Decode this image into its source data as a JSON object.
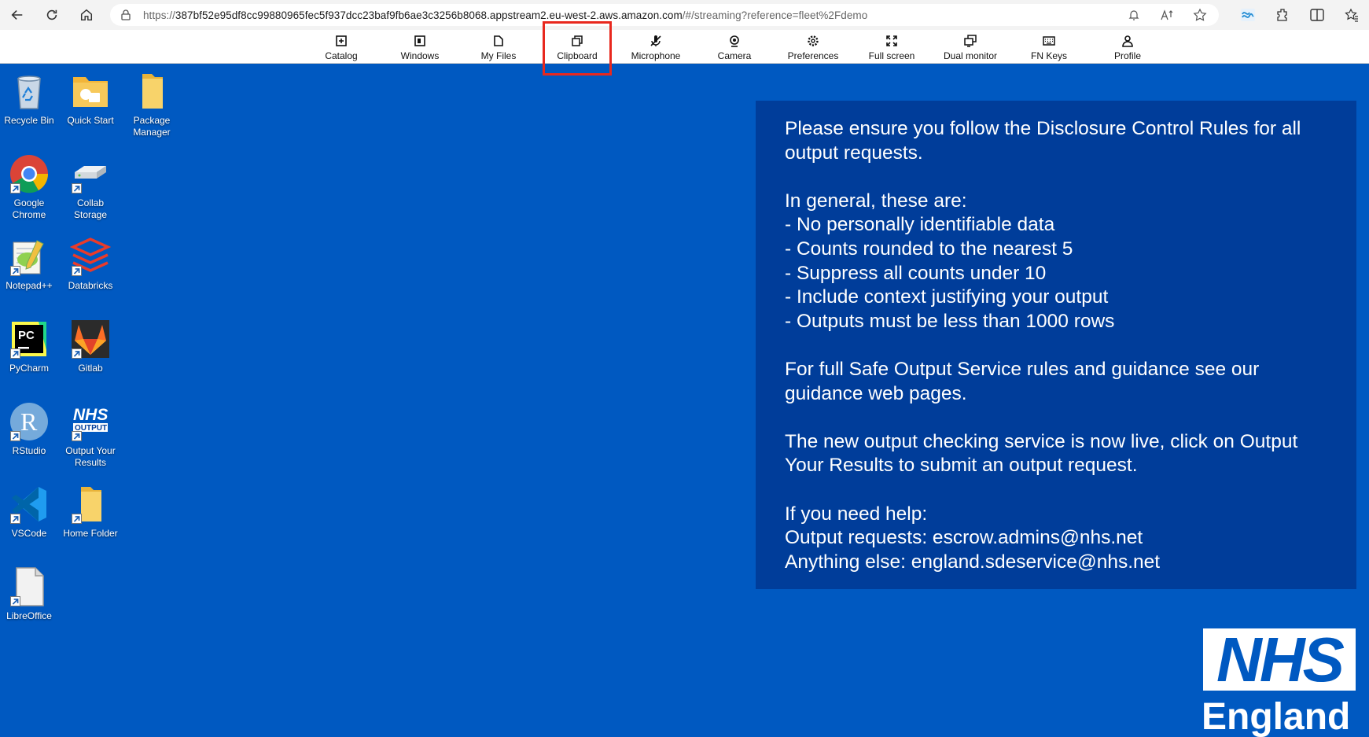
{
  "browser": {
    "url_prefix": "https://",
    "url_host": "387bf52e95df8cc99880965fec5f937dcc23baf9fb6ae3c3256b8068.appstream2.eu-west-2.aws.amazon.com",
    "url_path": "/#/streaming?reference=fleet%2Fdemo"
  },
  "toolbar": {
    "items": [
      {
        "label": "Catalog",
        "icon": "catalog-icon"
      },
      {
        "label": "Windows",
        "icon": "windows-icon"
      },
      {
        "label": "My Files",
        "icon": "my-files-icon"
      },
      {
        "label": "Clipboard",
        "icon": "clipboard-icon"
      },
      {
        "label": "Microphone",
        "icon": "microphone-icon"
      },
      {
        "label": "Camera",
        "icon": "camera-icon"
      },
      {
        "label": "Preferences",
        "icon": "gear-icon"
      },
      {
        "label": "Full screen",
        "icon": "full-screen-icon"
      },
      {
        "label": "Dual monitor",
        "icon": "dual-monitor-icon"
      },
      {
        "label": "FN Keys",
        "icon": "keyboard-icon"
      },
      {
        "label": "Profile",
        "icon": "profile-icon"
      }
    ],
    "highlighted": "Clipboard",
    "highlight_color": "#e8281e"
  },
  "desktop": {
    "icons": [
      {
        "label": "Recycle Bin"
      },
      {
        "label": "Quick Start"
      },
      {
        "label": "Package Manager"
      },
      {
        "label": "Google Chrome"
      },
      {
        "label": "Collab Storage"
      },
      {
        "label": "Notepad++"
      },
      {
        "label": "Databricks"
      },
      {
        "label": "PyCharm"
      },
      {
        "label": "Gitlab"
      },
      {
        "label": "RStudio"
      },
      {
        "label": "Output Your Results"
      },
      {
        "label": "VSCode"
      },
      {
        "label": "Home Folder"
      },
      {
        "label": "LibreOffice"
      }
    ],
    "nhs_output_logo_text": [
      "NHS",
      "OUTPUT"
    ],
    "background_color": "#0059c1"
  },
  "info_panel": {
    "lines": [
      "Please ensure you follow the Disclosure Control Rules for all",
      "output requests.",
      "",
      "In general, these are:",
      "- No personally identifiable data",
      "- Counts rounded to the nearest 5",
      "- Suppress all counts under 10",
      "- Include context justifying your output",
      "- Outputs must be less than 1000 rows",
      "",
      "For full Safe Output Service rules and guidance see our",
      "guidance web pages.",
      "",
      "The new output checking service is now live, click on Output",
      "Your Results to submit an output request.",
      "",
      "If you need help:",
      "Output requests: escrow.admins@nhs.net",
      "Anything else: england.sdeservice@nhs.net"
    ],
    "background_color": "#003d9a"
  },
  "logo": {
    "nhs": "NHS",
    "region": "England"
  }
}
